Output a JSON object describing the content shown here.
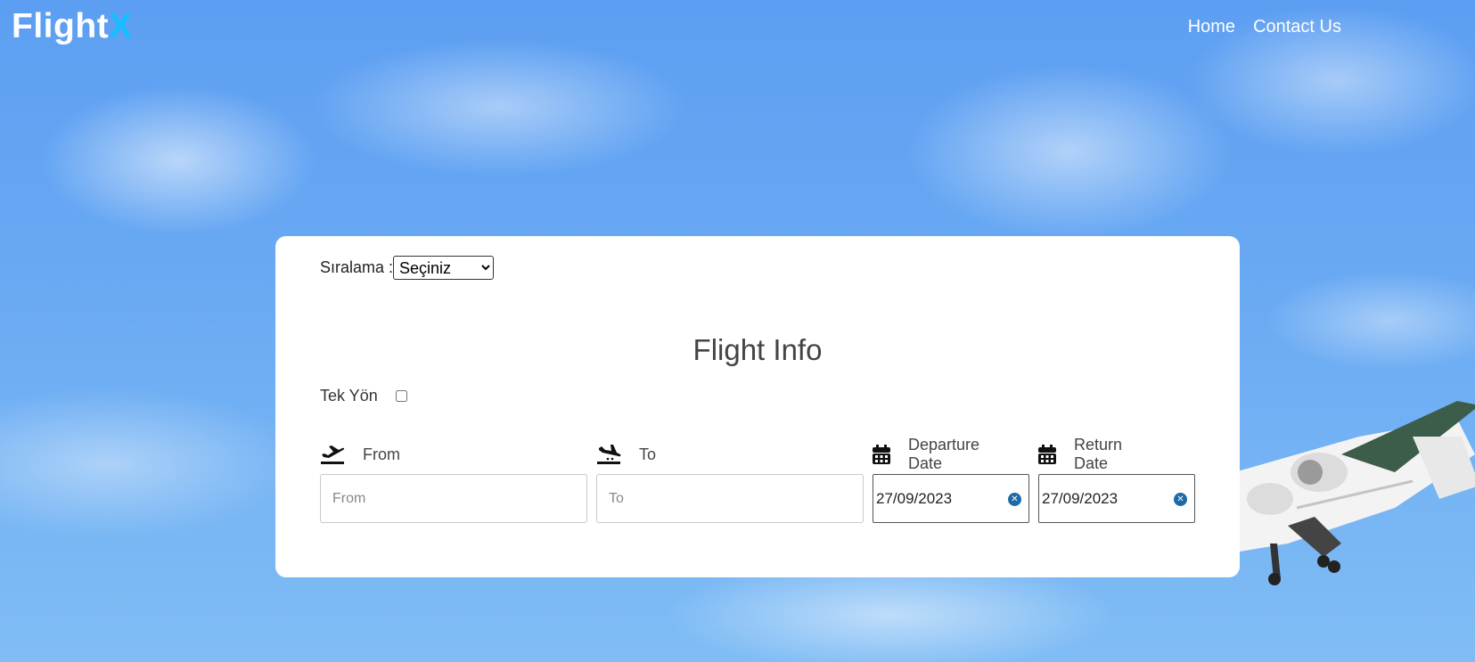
{
  "header": {
    "logo_main": "Flight",
    "logo_accent": "X",
    "nav": [
      {
        "label": "Home"
      },
      {
        "label": "Contact Us"
      }
    ]
  },
  "form": {
    "sort_label": "Sıralama :",
    "sort_selected": "Seçiniz",
    "title": "Flight Info",
    "oneway_label": "Tek Yön",
    "oneway_checked": false,
    "from": {
      "label": "From",
      "placeholder": "From",
      "icon": "plane-departure-icon"
    },
    "to": {
      "label": "To",
      "placeholder": "To",
      "icon": "plane-arrival-icon"
    },
    "departure": {
      "label": "Departure Date",
      "value": "27/09/2023",
      "icon": "calendar-icon"
    },
    "return": {
      "label": "Return Date",
      "value": "27/09/2023",
      "icon": "calendar-icon"
    }
  },
  "colors": {
    "accent": "#14bfff",
    "clear_button": "#1e6aa8",
    "sky": "#6aaaf3"
  }
}
